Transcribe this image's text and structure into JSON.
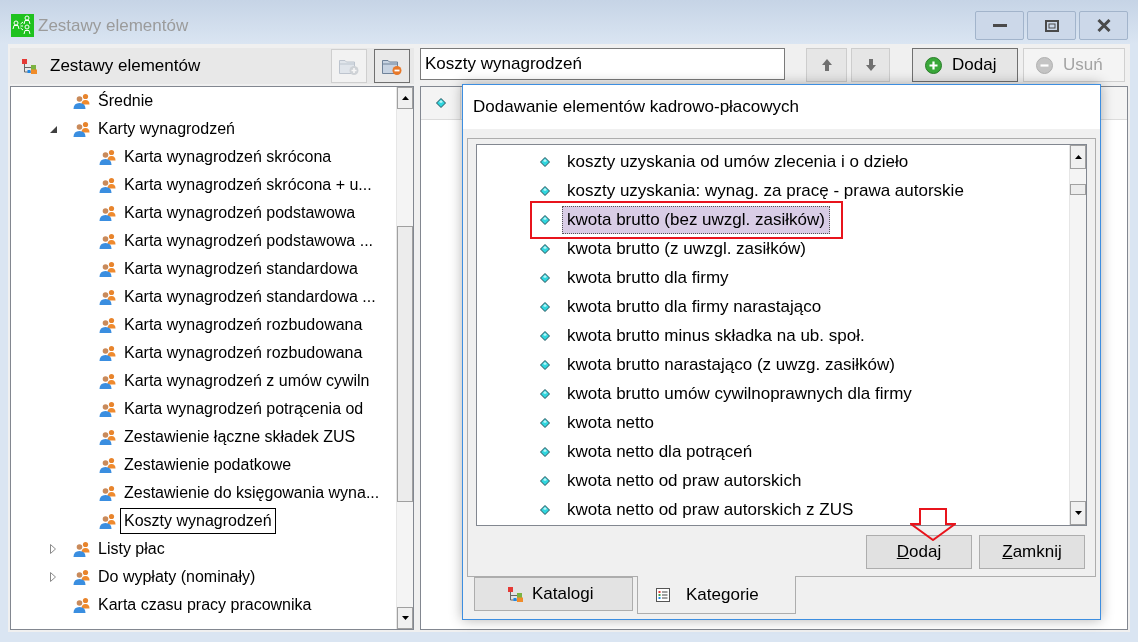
{
  "window": {
    "title": "Zestawy elementów"
  },
  "sets_panel": {
    "title": "Zestawy elementów",
    "tool_buttons": [
      {
        "kind": "add-folder",
        "disabled": true
      },
      {
        "kind": "remove-folder",
        "disabled": false
      }
    ],
    "tree": [
      {
        "label": "Średnie",
        "selected": false
      },
      {
        "label": "Karty wynagrodzeń",
        "expanded": true,
        "selected": false,
        "children": [
          {
            "label": "Karta wynagrodzeń skrócona",
            "selected": false
          },
          {
            "label": "Karta wynagrodzeń skrócona + u...",
            "selected": false
          },
          {
            "label": "Karta wynagrodzeń podstawowa",
            "selected": false
          },
          {
            "label": "Karta wynagrodzeń podstawowa ...",
            "selected": false
          },
          {
            "label": "Karta wynagrodzeń standardowa",
            "selected": false
          },
          {
            "label": "Karta wynagrodzeń standardowa ...",
            "selected": false
          },
          {
            "label": "Karta wynagrodzeń rozbudowana",
            "selected": false
          },
          {
            "label": "Karta wynagrodzeń rozbudowana",
            "selected": false
          },
          {
            "label": "Karta wynagrodzeń z umów cywiln",
            "selected": false
          },
          {
            "label": "Karta wynagrodzeń potrącenia od",
            "selected": false
          },
          {
            "label": "Zestawienie łączne składek ZUS",
            "selected": false
          },
          {
            "label": "Zestawienie podatkowe",
            "selected": false
          },
          {
            "label": "Zestawienie do księgowania wyna...",
            "selected": false
          },
          {
            "label": "Koszty wynagrodzeń",
            "selected": true
          }
        ]
      },
      {
        "label": "Listy płac",
        "expanded": false,
        "selected": false
      },
      {
        "label": "Do wypłaty (nominały)",
        "expanded": false,
        "selected": false
      },
      {
        "label": "Karta czasu pracy pracownika",
        "selected": false
      }
    ]
  },
  "toolbar": {
    "name_field": {
      "value": "Koszty wynagrodzeń"
    },
    "buttons": [
      {
        "kind": "add",
        "label": "Dodaj",
        "disabled": false
      },
      {
        "kind": "remove",
        "label": "Usuń",
        "disabled": true
      }
    ]
  },
  "dialog": {
    "title": "Dodawanie elementów kadrowo-płacowych",
    "items": [
      {
        "label": "koszty uzyskania od umów zlecenia i o dzieło",
        "selected": false,
        "marked": false
      },
      {
        "label": "koszty uzyskania: wynag. za pracę - prawa autorskie",
        "selected": false,
        "marked": false
      },
      {
        "label": "kwota brutto (bez uwzgl. zasiłków)",
        "selected": true,
        "marked": true
      },
      {
        "label": "kwota brutto (z uwzgl. zasiłków)",
        "selected": false,
        "marked": false
      },
      {
        "label": "kwota brutto dla firmy",
        "selected": false,
        "marked": false
      },
      {
        "label": "kwota brutto dla firmy narastająco",
        "selected": false,
        "marked": false
      },
      {
        "label": "kwota brutto minus składka na ub. społ.",
        "selected": false,
        "marked": false
      },
      {
        "label": "kwota brutto narastająco (z uwzg. zasiłków)",
        "selected": false,
        "marked": false
      },
      {
        "label": "kwota brutto umów cywilnoprawnych dla firmy",
        "selected": false,
        "marked": false
      },
      {
        "label": "kwota netto",
        "selected": false,
        "marked": false
      },
      {
        "label": "kwota netto dla potrąceń",
        "selected": false,
        "marked": false
      },
      {
        "label": "kwota netto od praw autorskich",
        "selected": false,
        "marked": false
      },
      {
        "label": "kwota netto od praw autorskich z ZUS",
        "selected": false,
        "marked": false
      }
    ],
    "buttons": [
      {
        "label": "Dodaj",
        "marked": true
      },
      {
        "label": "Zamknij",
        "marked": false
      }
    ],
    "tabs": [
      {
        "kind": "catalogs",
        "label": "Katalogi",
        "selected": false
      },
      {
        "kind": "categories",
        "label": "Kategorie",
        "selected": true
      }
    ]
  }
}
